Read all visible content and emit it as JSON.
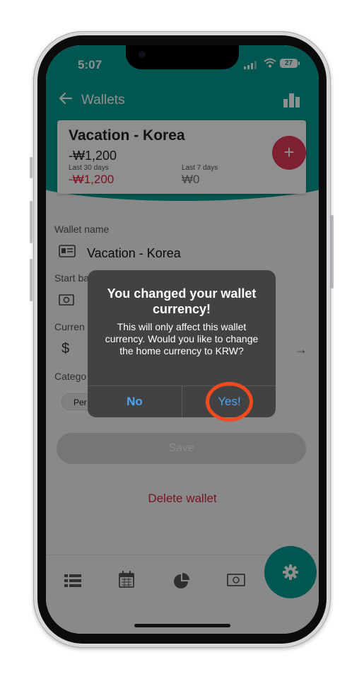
{
  "status_bar": {
    "time": "5:07",
    "battery": "27"
  },
  "header": {
    "title": "Wallets",
    "back_icon": "arrow-left-icon",
    "stats_icon": "bar-chart-icon"
  },
  "wallet_card": {
    "title": "Vacation - Korea",
    "total": "-₩1,200",
    "last_30_label": "Last 30 days",
    "last_30_value": "-₩1,200",
    "last_7_label": "Last 7 days",
    "last_7_value": "₩0",
    "add_label": "+"
  },
  "form": {
    "wallet_name_label": "Wallet name",
    "wallet_name_value": "Vacation - Korea",
    "start_balance_label": "Start ba",
    "currency_label": "Curren",
    "currency_symbol": "$",
    "category_label": "Catego",
    "category_chip": "Per",
    "save_label": "Save",
    "delete_label": "Delete wallet"
  },
  "tabs": [
    "list-icon",
    "calendar-icon",
    "pie-chart-icon",
    "money-icon",
    "gear-icon"
  ],
  "dialog": {
    "title": "You changed your wallet currency!",
    "message": "This will only affect this wallet currency. Would you like to change the home currency to KRW?",
    "no_label": "No",
    "yes_label": "Yes!"
  },
  "colors": {
    "accent": "#009a8f",
    "danger": "#d6253c",
    "dialog_button": "#4fa3f5",
    "highlight": "#f04a1e"
  }
}
